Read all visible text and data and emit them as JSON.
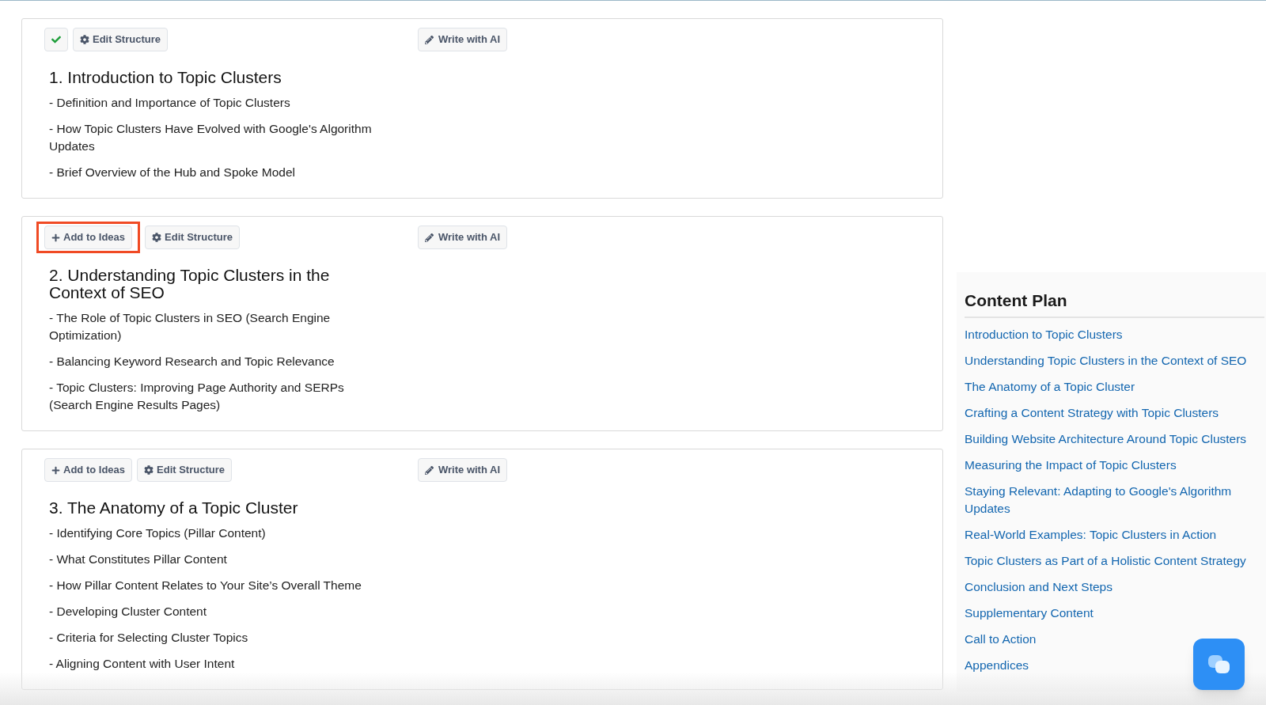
{
  "sections": [
    {
      "buttons": [
        {
          "kind": "check",
          "highlighted": false
        },
        {
          "kind": "edit",
          "label": "Edit Structure",
          "highlighted": false
        }
      ],
      "write_button": "Write with AI",
      "title": "1. Introduction to Topic Clusters",
      "bullets": [
        "- Definition and Importance of Topic Clusters",
        "- How Topic Clusters Have Evolved with Google's Algorithm Updates",
        "- Brief Overview of the Hub and Spoke Model"
      ]
    },
    {
      "buttons": [
        {
          "kind": "add",
          "label": "Add to Ideas",
          "highlighted": true
        },
        {
          "kind": "edit",
          "label": "Edit Structure",
          "highlighted": false
        }
      ],
      "write_button": "Write with AI",
      "title": "2. Understanding Topic Clusters in the Context of SEO",
      "bullets": [
        "- The Role of Topic Clusters in SEO (Search Engine Optimization)",
        "- Balancing Keyword Research and Topic Relevance",
        "- Topic Clusters: Improving Page Authority and SERPs (Search Engine Results Pages)"
      ]
    },
    {
      "buttons": [
        {
          "kind": "add",
          "label": "Add to Ideas",
          "highlighted": false
        },
        {
          "kind": "edit",
          "label": "Edit Structure",
          "highlighted": false
        }
      ],
      "write_button": "Write with AI",
      "title": "3. The Anatomy of a Topic Cluster",
      "bullets": [
        "- Identifying Core Topics (Pillar Content)",
        "- What Constitutes Pillar Content",
        "- How Pillar Content Relates to Your Site’s Overall Theme",
        "- Developing Cluster Content",
        "- Criteria for Selecting Cluster Topics",
        "- Aligning Content with User Intent"
      ]
    }
  ],
  "content_plan": {
    "title": "Content Plan",
    "links": [
      "Introduction to Topic Clusters",
      "Understanding Topic Clusters in the Context of SEO",
      "The Anatomy of a Topic Cluster",
      "Crafting a Content Strategy with Topic Clusters",
      "Building Website Architecture Around Topic Clusters",
      "Measuring the Impact of Topic Clusters",
      "Staying Relevant: Adapting to Google's Algorithm Updates",
      "Real-World Examples: Topic Clusters in Action",
      "Topic Clusters as Part of a Holistic Content Strategy",
      "Conclusion and Next Steps",
      "Supplementary Content",
      "Call to Action",
      "Appendices"
    ]
  }
}
